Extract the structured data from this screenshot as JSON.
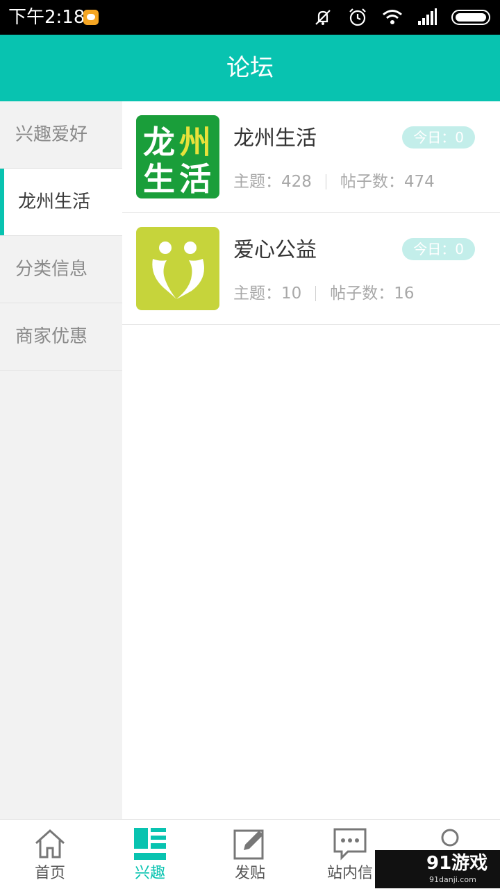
{
  "status_bar": {
    "time": "下午2:18",
    "icons": [
      "notification-icon",
      "mute-icon",
      "alarm-icon",
      "wifi-icon",
      "signal-icon",
      "battery-icon"
    ]
  },
  "header": {
    "title": "论坛"
  },
  "sidebar": {
    "items": [
      {
        "label": "兴趣爱好",
        "active": false
      },
      {
        "label": "龙州生活",
        "active": true
      },
      {
        "label": "分类信息",
        "active": false
      },
      {
        "label": "商家优惠",
        "active": false
      }
    ]
  },
  "forums": [
    {
      "name": "龙州生活",
      "logo_text": [
        "龙",
        "州",
        "生",
        "活"
      ],
      "today": "今日：0",
      "topics": "主题：428",
      "posts": "帖子数：474",
      "logo_color": "#1a9e3a"
    },
    {
      "name": "爱心公益",
      "today": "今日：0",
      "topics": "主题：10",
      "posts": "帖子数：16",
      "logo_color": "#c6d43b"
    }
  ],
  "bottom_nav": {
    "tabs": [
      {
        "label": "首页",
        "icon": "home-icon",
        "active": false
      },
      {
        "label": "兴趣",
        "icon": "interest-list-icon",
        "active": true
      },
      {
        "label": "发贴",
        "icon": "compose-icon",
        "active": false
      },
      {
        "label": "站内信",
        "icon": "message-icon",
        "active": false
      },
      {
        "label": "",
        "icon": "user-icon",
        "active": false
      }
    ]
  },
  "watermark": {
    "title": "91游戏",
    "url": "91danji.com"
  },
  "colors": {
    "accent": "#08c3b0",
    "badge": "#c3eeea"
  }
}
